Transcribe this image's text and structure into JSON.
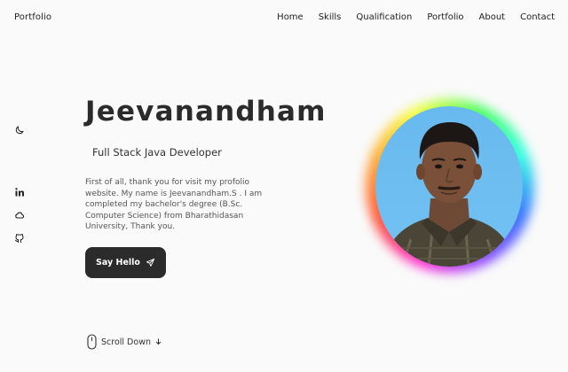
{
  "header": {
    "brand": "Portfolio",
    "nav": [
      "Home",
      "Skills",
      "Qualification",
      "Portfolio",
      "About",
      "Contact"
    ]
  },
  "hero": {
    "name": "Jeevanandham",
    "role": "Full Stack Java Developer",
    "description": "First of all, thank you for visit my profolio website. My name is Jeevanandham.S . I am completed my bachelor's degree (B.Sc. Computer Science) from Bharathidasan University, Thank you.",
    "cta_label": "Say Hello"
  },
  "scroll": {
    "label": "Scroll Down"
  },
  "icons": {
    "theme": "moon-icon",
    "social": [
      "linkedin-icon",
      "cloud-icon",
      "github-icon"
    ],
    "cta": "send-icon",
    "scroll": "mouse-icon",
    "scroll_arrow": "arrow-down-icon"
  },
  "colors": {
    "background": "#fafafa",
    "text": "#2b2b2b",
    "button": "#2b2b2b",
    "photo_background": "#6ebef0"
  }
}
